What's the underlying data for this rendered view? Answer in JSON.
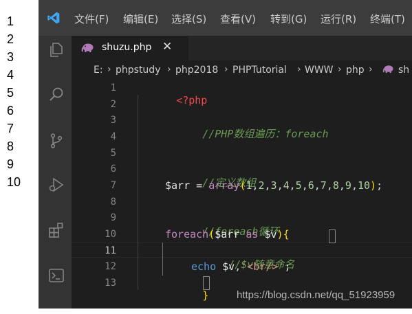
{
  "output": {
    "lines": [
      "1",
      "2",
      "3",
      "4",
      "5",
      "6",
      "7",
      "8",
      "9",
      "10"
    ]
  },
  "titlebar": {
    "menus": [
      "文件(F)",
      "编辑(E)",
      "选择(S)",
      "查看(V)",
      "转到(G)",
      "运行(R)",
      "终端(T)"
    ]
  },
  "activitybar": {
    "icons": [
      "explorer-icon",
      "search-icon",
      "source-control-icon",
      "run-debug-icon",
      "extensions-icon",
      "remote-terminal-icon"
    ]
  },
  "tab": {
    "label": "shuzu.php",
    "close": "✕"
  },
  "breadcrumb": {
    "items": [
      "E:",
      "phpstudy",
      "php2018",
      "PHPTutorial",
      "WWW",
      "php",
      "sh"
    ]
  },
  "editor": {
    "line_numbers": [
      "1",
      "2",
      "3",
      "4",
      "5",
      "6",
      "7",
      "8",
      "9",
      "10",
      "11",
      "12",
      "13"
    ],
    "active_line": "11",
    "code": {
      "l1": {
        "tag": "<?php"
      },
      "l3": {
        "comment": "//PHP数组遍历：foreach"
      },
      "l5": {
        "comment": "//定义数组"
      },
      "l7": {
        "var": "$arr",
        "op": " = ",
        "fn": "array",
        "open": "(",
        "nums": [
          "1",
          "2",
          "3",
          "4",
          "5",
          "6",
          "7",
          "8",
          "9",
          "10"
        ],
        "close": ")",
        "end": ";"
      },
      "l9": {
        "comment": "//foreach循环"
      },
      "l10": {
        "kw": "foreach",
        "open": "(",
        "var1": "$arr",
        "as": " as ",
        "var2": "$v",
        "close": ")",
        "brace": "{"
      },
      "l11": {
        "comment": "//$v随意命名"
      },
      "l12": {
        "echo": "echo",
        "var": " $v",
        "comma": ",",
        "str": "'<br/>'",
        "end": ";"
      },
      "l13": {
        "brace": "}"
      }
    }
  },
  "watermark": "https://blog.csdn.net/qq_51923959"
}
